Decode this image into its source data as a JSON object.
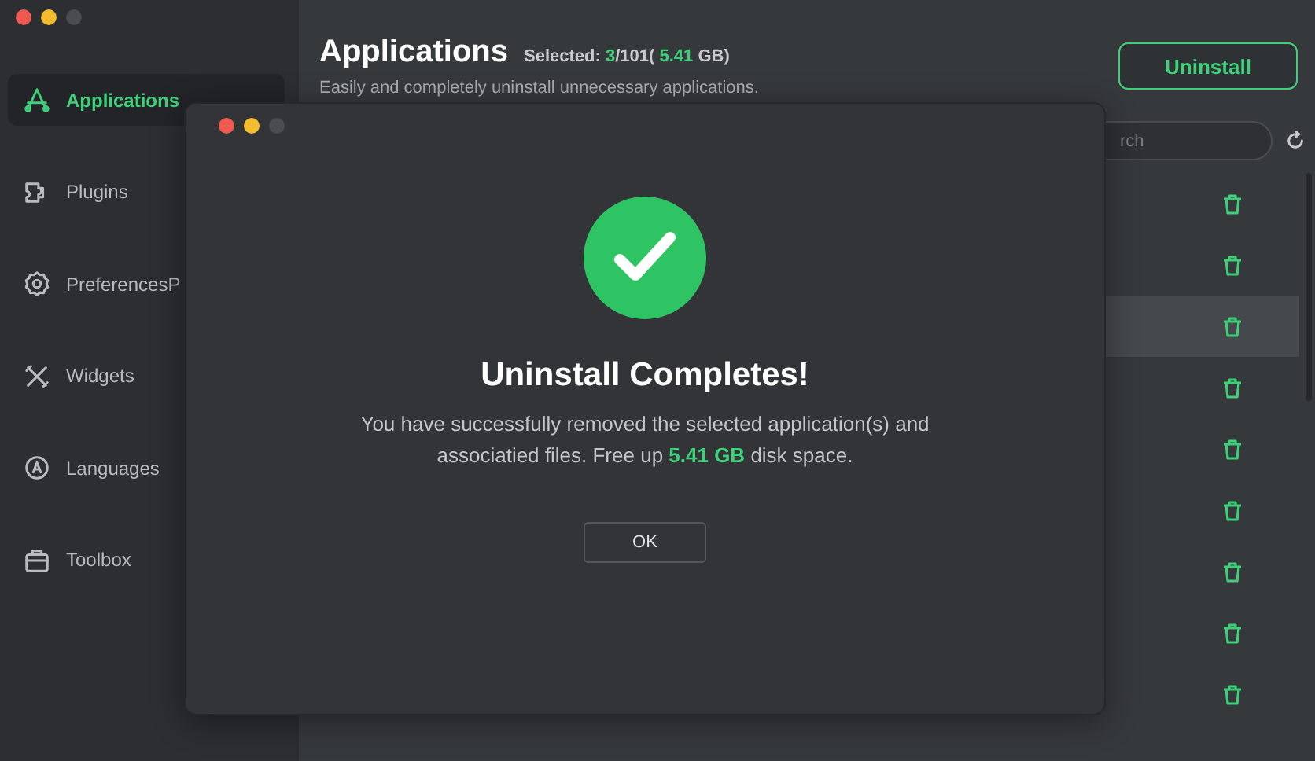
{
  "sidebar": {
    "items": [
      {
        "label": "Applications",
        "selected": true
      },
      {
        "label": "Plugins",
        "selected": false
      },
      {
        "label": "PreferencesP",
        "selected": false
      },
      {
        "label": "Widgets",
        "selected": false
      },
      {
        "label": "Languages",
        "selected": false
      },
      {
        "label": "Toolbox",
        "selected": false
      }
    ]
  },
  "header": {
    "title": "Applications",
    "selected_prefix": "Selected: ",
    "selected_count": "3",
    "selected_total": "/101( ",
    "selected_size": "5.41",
    "selected_unit": " GB)",
    "subtitle": "Easily and completely uninstall unnecessary applications.",
    "uninstall_button": "Uninstall"
  },
  "search": {
    "placeholder": "rch"
  },
  "rows": [
    {
      "selected": false
    },
    {
      "selected": false
    },
    {
      "selected": true
    },
    {
      "selected": false
    },
    {
      "selected": false
    },
    {
      "selected": false
    },
    {
      "selected": false
    },
    {
      "selected": false
    },
    {
      "selected": false
    }
  ],
  "dialog": {
    "title": "Uninstall Completes!",
    "message": "You have successfully removed the selected application(s) and associatied files. Free up **5.41 GB** disk space.",
    "ok_button": "OK"
  }
}
